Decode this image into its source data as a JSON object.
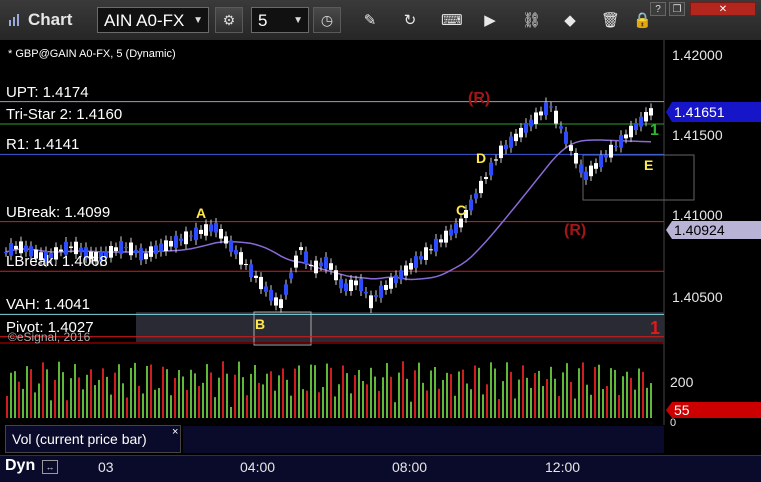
{
  "window": {
    "title": "Chart",
    "help_label": "?",
    "restore_label": "❐",
    "close_label": "✕"
  },
  "toolbar": {
    "symbol_value": "AIN A0-FX",
    "interval_value": "5",
    "icons": [
      "gear-icon",
      "clock-icon",
      "pencil-icon",
      "refresh-icon",
      "keyboard-icon",
      "play-icon",
      "link-icon",
      "trash-icon",
      "lock-icon"
    ]
  },
  "chart": {
    "header": "* GBP@GAIN A0-FX, 5 (Dynamic)",
    "watermark": "©eSignal, 2016",
    "price_axis": [
      "1.42000",
      "1.41500",
      "1.41000",
      "1.40500"
    ],
    "last_price": "1.41651",
    "ma_price": "1.40924",
    "levels": [
      {
        "label": "UPT: 1.4174",
        "price": 1.4174,
        "color": "#9b9bbf"
      },
      {
        "label": "Tri-Star 2: 1.4160",
        "price": 1.416,
        "color": "#2e9e2e"
      },
      {
        "label": "R1: 1.4141",
        "price": 1.4141,
        "color": "#3a5cd8"
      },
      {
        "label": "UBreak: 1.4099",
        "price": 1.4099,
        "color": "#d21f1f"
      },
      {
        "label": "LBreak: 1.4068",
        "price": 1.4068,
        "color": "#d21f1f"
      },
      {
        "label": "VAH: 1.4041",
        "price": 1.4041,
        "color": "#7fd7e0"
      },
      {
        "label": "Pivot: 1.4027",
        "price": 1.4027,
        "color": "#e01a1a"
      }
    ],
    "markers": [
      {
        "text": "A",
        "color": "#ffe84d"
      },
      {
        "text": "B",
        "color": "#ffe84d"
      },
      {
        "text": "C",
        "color": "#ffe84d"
      },
      {
        "text": "D",
        "color": "#ffe84d"
      },
      {
        "text": "E",
        "color": "#ffe84d"
      },
      {
        "text": "(R)",
        "color": "#a51515"
      },
      {
        "text": "(R)",
        "color": "#a51515"
      },
      {
        "text": "1",
        "color": "#2fb52f"
      },
      {
        "text": "1",
        "color": "#e01a1a"
      }
    ]
  },
  "volume": {
    "legend": "Vol (current price bar)",
    "legend_close": "×",
    "axis": [
      "200",
      "0"
    ],
    "last_value": "55"
  },
  "time_axis": {
    "dyn_label": "Dyn",
    "ticks": [
      "03",
      "04:00",
      "08:00",
      "12:00"
    ]
  },
  "colors": {
    "background": "#000000",
    "panel": "#000000",
    "accent_blue": "#1616c8",
    "accent_red": "#cc0000",
    "candle_up": "#ffffff",
    "candle_down": "#2d4bff",
    "ma": "#8a6ad6"
  }
}
